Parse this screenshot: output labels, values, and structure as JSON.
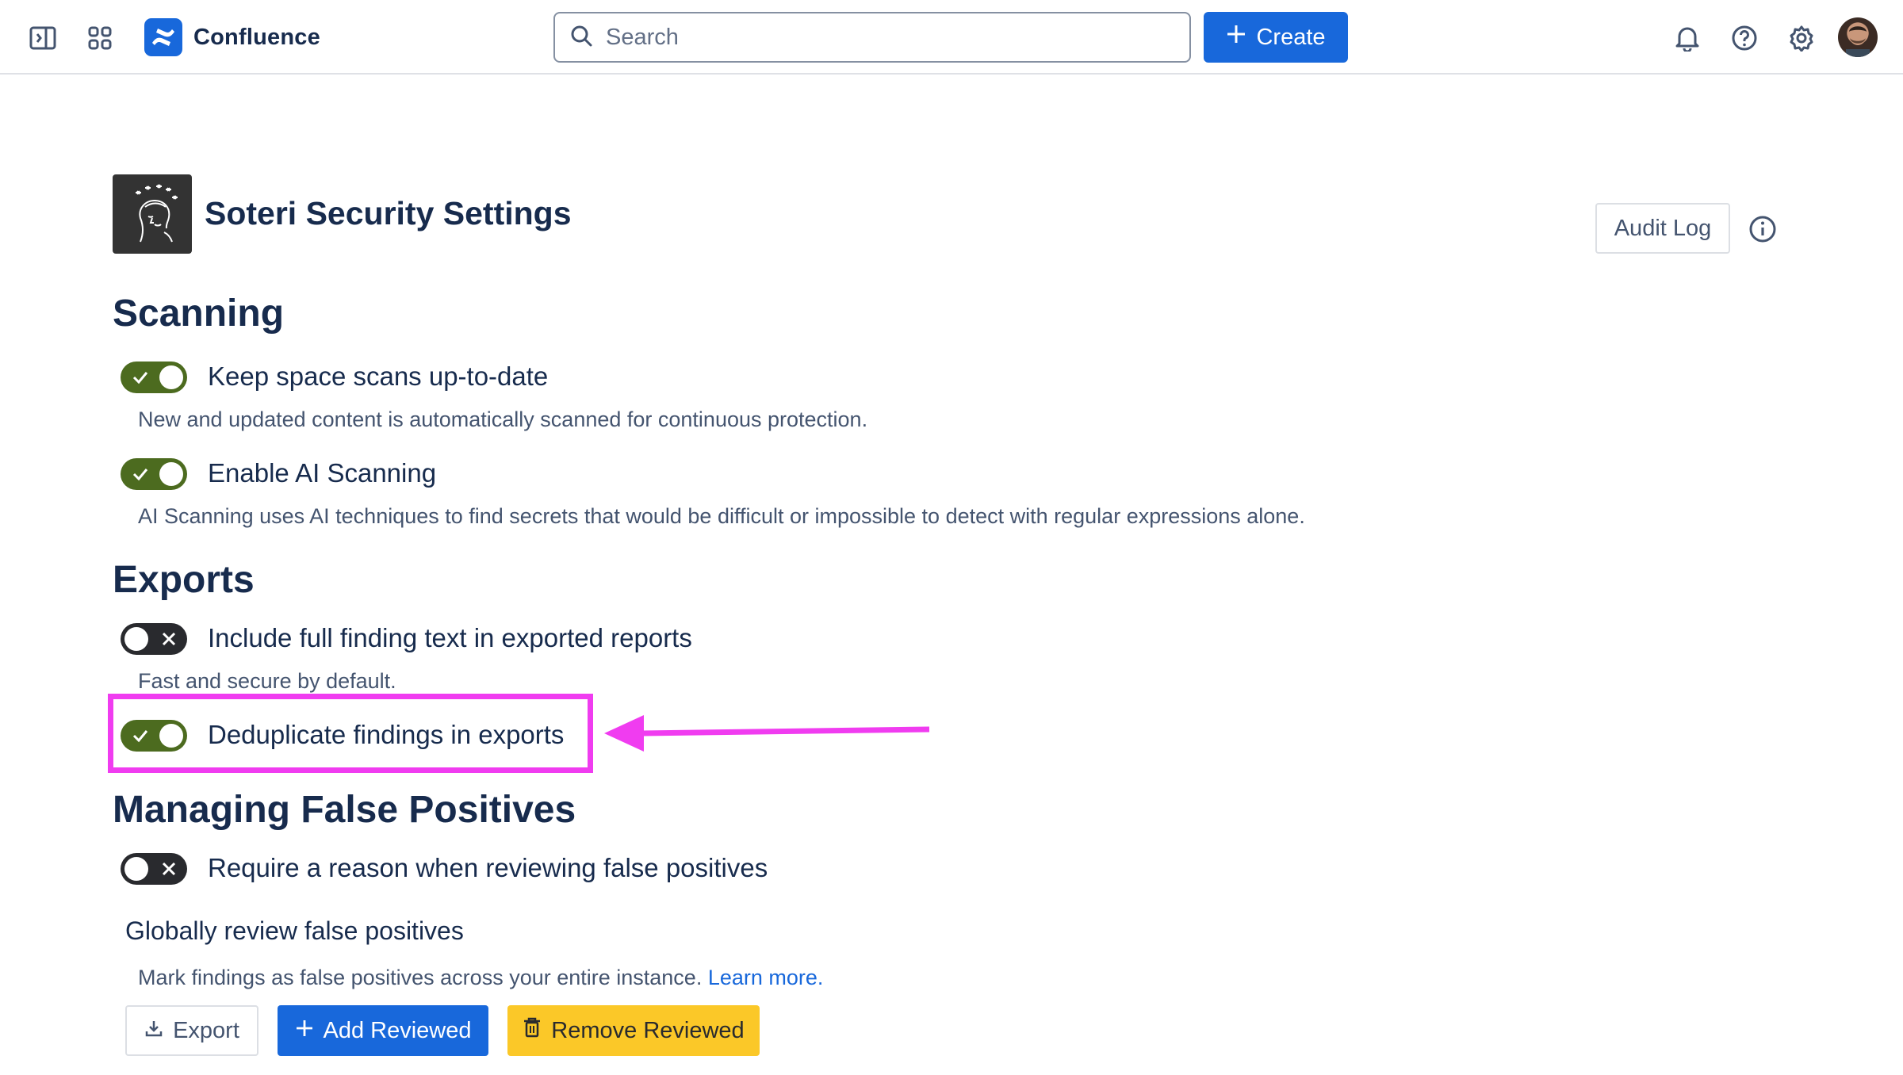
{
  "app": {
    "name": "Confluence",
    "search_placeholder": "Search",
    "create_label": "Create",
    "brand_color": "#1868db"
  },
  "header_icons": [
    "sidebar-toggle-icon",
    "app-switcher-icon",
    "bell-icon",
    "help-icon",
    "gear-icon"
  ],
  "page": {
    "title": "Soteri Security Settings",
    "audit_log_label": "Audit Log"
  },
  "sections": {
    "scanning": {
      "heading": "Scanning",
      "options": [
        {
          "label": "Keep space scans up-to-date",
          "enabled": true,
          "description": "New and updated content is automatically scanned for continuous protection."
        },
        {
          "label": "Enable AI Scanning",
          "enabled": true,
          "description": "AI Scanning uses AI techniques to find secrets that would be difficult or impossible to detect with regular expressions alone."
        }
      ]
    },
    "exports": {
      "heading": "Exports",
      "options": [
        {
          "label": "Include full finding text in exported reports",
          "enabled": false,
          "description": "Fast and secure by default."
        },
        {
          "label": "Deduplicate findings in exports",
          "enabled": true
        }
      ]
    },
    "false_positives": {
      "heading": "Managing False Positives",
      "options": [
        {
          "label": "Require a reason when reviewing false positives",
          "enabled": false
        }
      ],
      "global_review": {
        "heading": "Globally review false positives",
        "description": "Mark findings as false positives across your entire instance.",
        "link_text": "Learn more."
      },
      "buttons": {
        "export": "Export",
        "add_reviewed": "Add Reviewed",
        "remove_reviewed": "Remove Reviewed"
      }
    }
  },
  "colors": {
    "toggle_on": "#4c6b1f",
    "toggle_off": "#292a2e",
    "annotation": "#f03cf0",
    "warning_button": "#fbc828"
  }
}
